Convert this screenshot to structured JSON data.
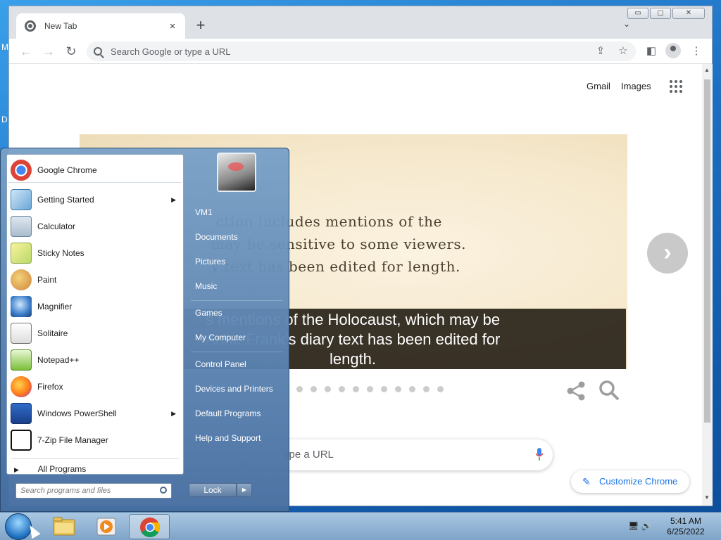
{
  "desktop": {
    "edge_m": "M",
    "edge_d": "D"
  },
  "browser": {
    "tab": {
      "title": "New Tab",
      "close": "×"
    },
    "newtab": "+",
    "tabsearch": "⌄",
    "window_controls": [
      "▭",
      "▢",
      "✕"
    ],
    "nav": {
      "back": "←",
      "forward": "→",
      "reload": "↻"
    },
    "omnibox": {
      "placeholder": "Search Google or type a URL"
    },
    "toolbar_icons": {
      "share": "⇪",
      "bookmark": "☆",
      "sidepanel": "◧",
      "menu": "⋮"
    }
  },
  "ntp": {
    "links": {
      "gmail": "Gmail",
      "images": "Images"
    },
    "doodle": {
      "text": "  ction includes mentions of the\n may be sensitive to some viewers.\n y text has been edited for length.",
      "caption_line1": "s mentions of the Holocaust, which may be",
      "caption_line2": "Anne Frank's diary text has been edited for",
      "caption_line3": "length.",
      "next": "›",
      "dot_count": 11
    },
    "search_placeholder": "ype a URL",
    "customize_label": "Customize Chrome",
    "customize_icon": "✎"
  },
  "start_menu": {
    "programs": [
      {
        "label": "Google Chrome",
        "icon": "chrome-icon",
        "submenu": false
      },
      {
        "label": "Getting Started",
        "icon": "getting-started-icon",
        "submenu": true
      },
      {
        "label": "Calculator",
        "icon": "calculator-icon",
        "submenu": false
      },
      {
        "label": "Sticky Notes",
        "icon": "sticky-notes-icon",
        "submenu": false
      },
      {
        "label": "Paint",
        "icon": "paint-icon",
        "submenu": false
      },
      {
        "label": "Magnifier",
        "icon": "magnifier-icon",
        "submenu": false
      },
      {
        "label": "Solitaire",
        "icon": "solitaire-icon",
        "submenu": false
      },
      {
        "label": "Notepad++",
        "icon": "notepadpp-icon",
        "submenu": false
      },
      {
        "label": "Firefox",
        "icon": "firefox-icon",
        "submenu": false
      },
      {
        "label": "Windows PowerShell",
        "icon": "powershell-icon",
        "submenu": true
      },
      {
        "label": "7-Zip File Manager",
        "icon": "7zip-icon",
        "submenu": false
      }
    ],
    "all_programs": "All Programs",
    "search_placeholder": "Search programs and files",
    "right_links": [
      "VM1",
      "Documents",
      "Pictures",
      "Music",
      "Games",
      "My Computer",
      "Control Panel",
      "Devices and Printers",
      "Default Programs",
      "Help and Support"
    ],
    "lock": "Lock",
    "lock_arrow": "▶"
  },
  "taskbar": {
    "clock_time": "5:41 AM",
    "clock_date": "6/25/2022",
    "tray_icons": "🖥 🔊"
  },
  "colors": {
    "accent": "#1a73e8",
    "taskbar": "#8fb2d4",
    "start_menu": "#5f86b2"
  }
}
